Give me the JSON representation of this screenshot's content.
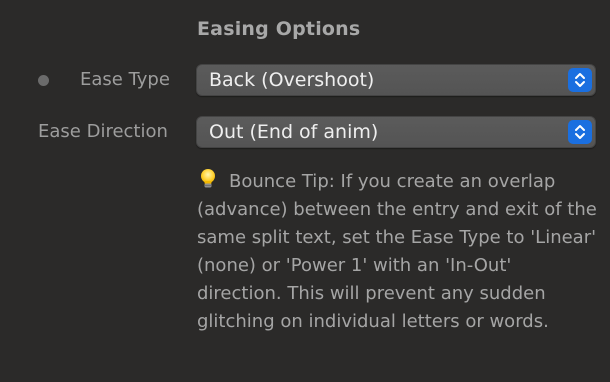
{
  "section": {
    "title": "Easing Options"
  },
  "ease_type": {
    "label": "Ease Type",
    "value": "Back (Overshoot)"
  },
  "ease_direction": {
    "label": "Ease Direction",
    "value": "Out (End of anim)"
  },
  "tip": {
    "icon": "lightbulb-icon",
    "text": "Bounce Tip: If you create an overlap (advance) between the entry and exit of the same split text, set the Ease Type to 'Linear' (none) or 'Power 1' with an 'In-Out' direction. This will prevent any sudden glitching on individual letters or words."
  },
  "colors": {
    "background": "#2b2a29",
    "select_bg": "#575757",
    "accent": "#1a6fe0",
    "label_text": "#9d9d9d",
    "value_text": "#efefef"
  }
}
